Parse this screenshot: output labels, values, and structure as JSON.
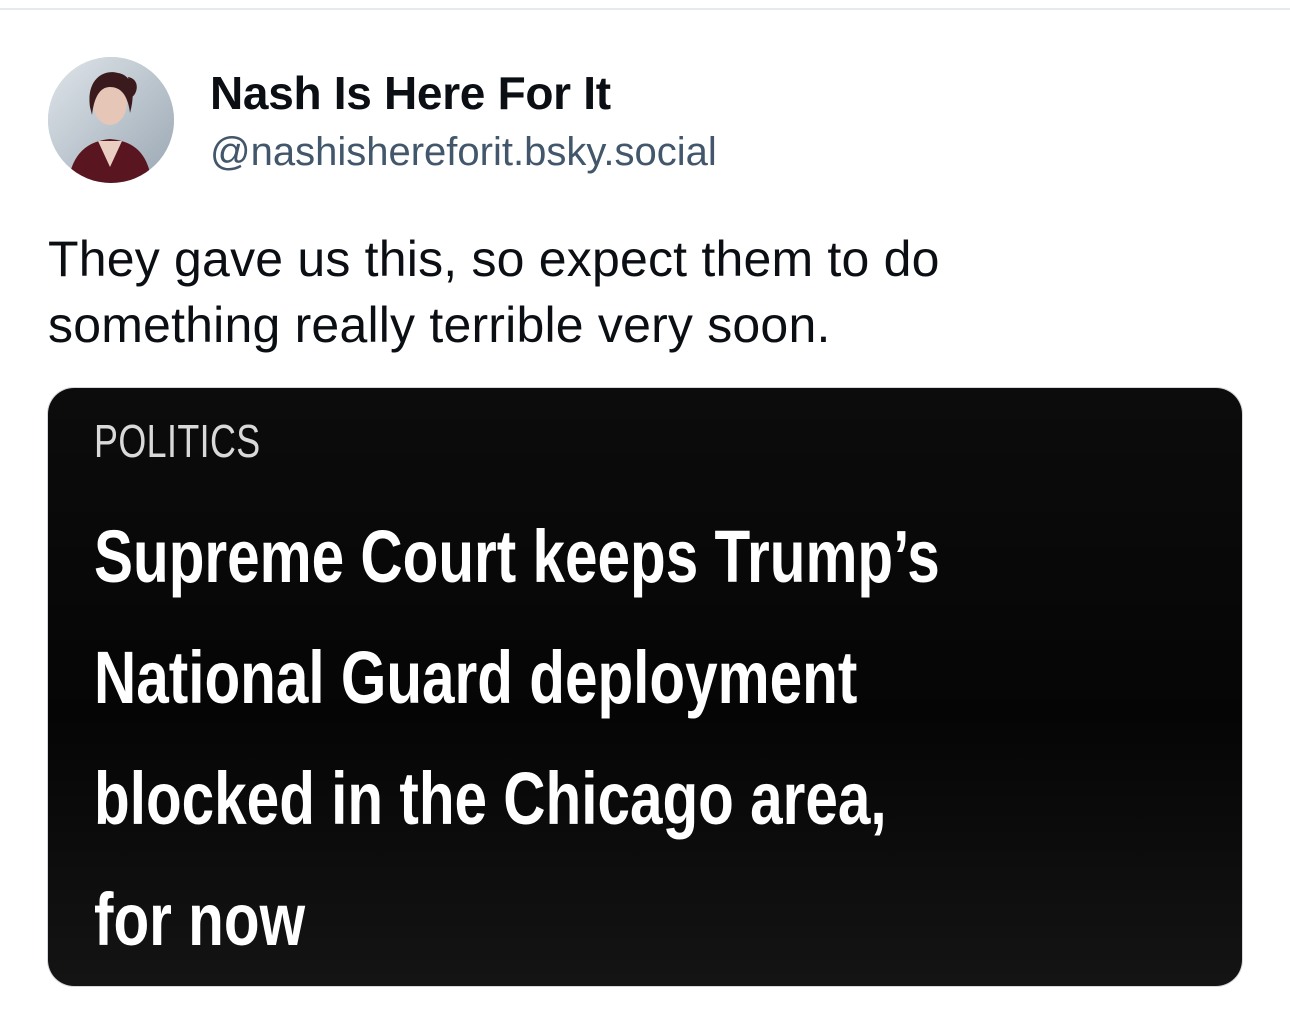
{
  "author": {
    "display_name": "Nash Is Here For It",
    "handle": "@nashishereforit.bsky.social",
    "avatar_icon": "profile-photo"
  },
  "post": {
    "text_lines": [
      "They gave us this, so expect them to do",
      "something really terrible very soon."
    ]
  },
  "embed": {
    "category": "POLITICS",
    "headline_lines": [
      "Supreme Court keeps Trump’s",
      "National Guard deployment",
      "blocked in the Chicago area,",
      "for now"
    ]
  },
  "colors": {
    "name_text": "#0b0f14",
    "handle_text": "#42576c",
    "embed_background": "#0a0a0a",
    "embed_text": "#ffffff"
  }
}
